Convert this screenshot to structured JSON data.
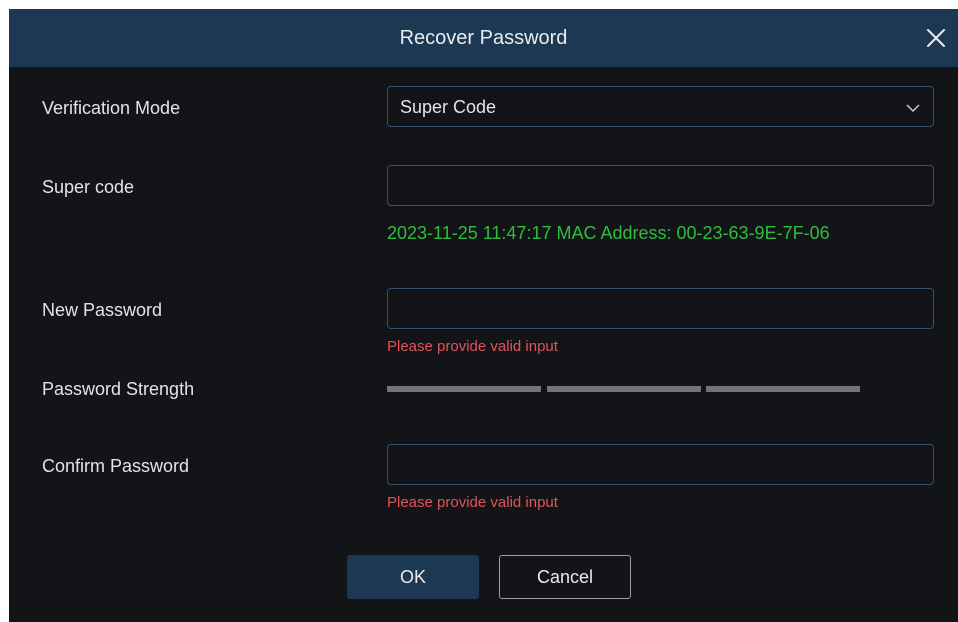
{
  "dialog": {
    "title": "Recover Password"
  },
  "form": {
    "verification_mode": {
      "label": "Verification Mode",
      "selected": "Super Code"
    },
    "super_code": {
      "label": "Super code",
      "value": "",
      "info": "2023-11-25 11:47:17 MAC Address: 00-23-63-9E-7F-06"
    },
    "new_password": {
      "label": "New Password",
      "value": "",
      "error": "Please provide valid input"
    },
    "password_strength": {
      "label": "Password Strength",
      "level": 0,
      "segments": 3
    },
    "confirm_password": {
      "label": "Confirm Password",
      "value": "",
      "error": "Please provide valid input"
    }
  },
  "buttons": {
    "ok_label": "OK",
    "cancel_label": "Cancel"
  },
  "colors": {
    "titlebar": "#1d3853",
    "background": "#121418",
    "info_text": "#2fbd3c",
    "error_text": "#e2525a",
    "input_border": "#34516d",
    "strength_inactive": "#727479"
  },
  "icons": {
    "close": "close-icon",
    "dropdown": "chevron-down-icon"
  }
}
